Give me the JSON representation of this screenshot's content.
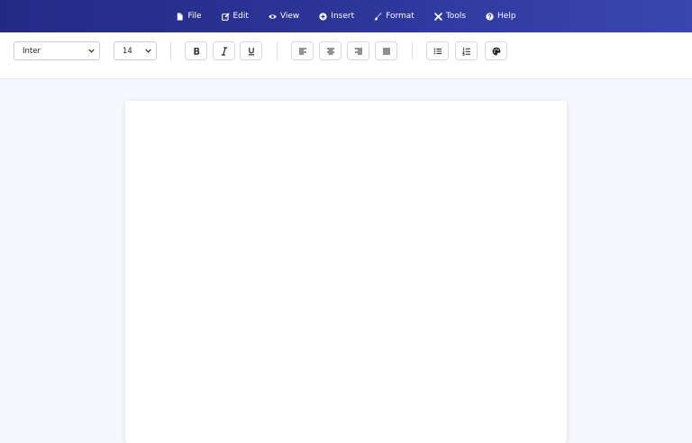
{
  "menu": {
    "items": [
      {
        "label": "File",
        "icon": "file-icon"
      },
      {
        "label": "Edit",
        "icon": "edit-icon"
      },
      {
        "label": "View",
        "icon": "eye-icon"
      },
      {
        "label": "Insert",
        "icon": "plus-circle-icon"
      },
      {
        "label": "Format",
        "icon": "paintbrush-icon"
      },
      {
        "label": "Tools",
        "icon": "tools-icon"
      },
      {
        "label": "Help",
        "icon": "question-circle-icon"
      }
    ]
  },
  "toolbar": {
    "font_family": "Inter",
    "font_size": "14",
    "buttons": [
      "bold-icon",
      "italic-icon",
      "underline-icon",
      "align-left-icon",
      "align-center-icon",
      "align-right-icon",
      "align-justify-icon",
      "bullet-list-icon",
      "numbered-list-icon",
      "palette-icon"
    ]
  },
  "colors": {
    "menubar_start": "#232a86",
    "menubar_end": "#3a47b0",
    "canvas_background": "#f5f7fd",
    "page": "#ffffff"
  }
}
